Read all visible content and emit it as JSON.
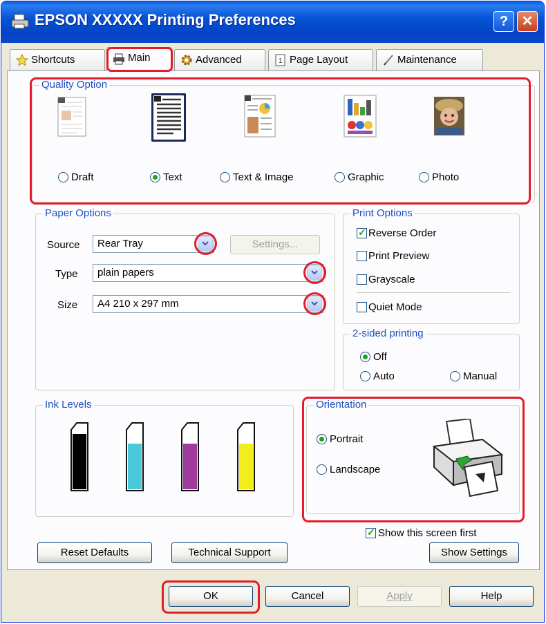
{
  "window": {
    "title": "EPSON XXXXX  Printing Preferences",
    "help_glyph": "?",
    "close_glyph": "✕"
  },
  "tabs": [
    {
      "label": "Shortcuts",
      "icon": "star-icon"
    },
    {
      "label": "Main",
      "icon": "printer-icon",
      "active": true
    },
    {
      "label": "Advanced",
      "icon": "gear-icon"
    },
    {
      "label": "Page Layout",
      "icon": "page-icon"
    },
    {
      "label": "Maintenance",
      "icon": "pen-icon"
    }
  ],
  "quality": {
    "label": "Quality Option",
    "options": [
      {
        "label": "Draft",
        "selected": false
      },
      {
        "label": "Text",
        "selected": true
      },
      {
        "label": "Text & Image",
        "selected": false
      },
      {
        "label": "Graphic",
        "selected": false
      },
      {
        "label": "Photo",
        "selected": false
      }
    ]
  },
  "paper": {
    "label": "Paper Options",
    "source_label": "Source",
    "source_value": "Rear Tray",
    "settings_label": "Settings...",
    "type_label": "Type",
    "type_value": "plain papers",
    "size_label": "Size",
    "size_value": "A4 210 x 297 mm"
  },
  "print_options": {
    "label": "Print Options",
    "items": [
      {
        "label": "Reverse Order",
        "checked": true
      },
      {
        "label": "Print Preview",
        "checked": false
      },
      {
        "label": "Grayscale",
        "checked": false
      },
      {
        "label": "Quiet Mode",
        "checked": false
      }
    ]
  },
  "two_sided": {
    "label": "2-sided printing",
    "options": [
      {
        "label": "Off",
        "selected": true
      },
      {
        "label": "Auto",
        "selected": false
      },
      {
        "label": "Manual",
        "selected": false
      }
    ]
  },
  "ink": {
    "label": "Ink Levels",
    "colors": [
      "#000000",
      "#49c8d8",
      "#a03a9c",
      "#f2ee1c"
    ]
  },
  "orientation": {
    "label": "Orientation",
    "options": [
      {
        "label": "Portrait",
        "selected": true
      },
      {
        "label": "Landscape",
        "selected": false
      }
    ]
  },
  "show_first": {
    "label": "Show this screen first",
    "checked": true
  },
  "buttons": {
    "reset": "Reset Defaults",
    "tech": "Technical Support",
    "show_settings": "Show Settings",
    "ok": "OK",
    "cancel": "Cancel",
    "apply": "Apply",
    "help": "Help"
  },
  "colors": {
    "highlight": "#e21c2a",
    "group_label": "#1e4fbf",
    "title_bar": "#0654d6"
  }
}
